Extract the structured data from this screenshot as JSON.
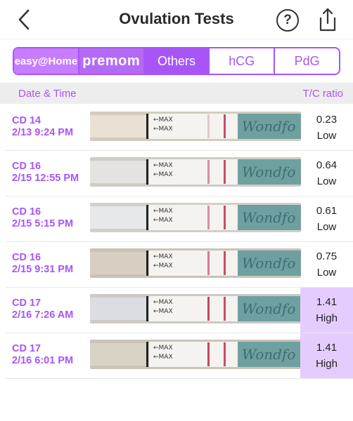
{
  "header": {
    "title": "Ovulation Tests"
  },
  "tabs": [
    {
      "label": "easy@Home",
      "style": "brand"
    },
    {
      "label": "premom",
      "style": "brand2"
    },
    {
      "label": "Others",
      "style": "active"
    },
    {
      "label": "hCG",
      "style": ""
    },
    {
      "label": "PdG",
      "style": ""
    }
  ],
  "columns": {
    "date_time": "Date & Time",
    "tc_ratio": "T/C ratio"
  },
  "colors": {
    "accent": "#a855f7",
    "high_bg": "#e5ccff"
  },
  "tests": [
    {
      "cd": "CD 14",
      "datetime": "2/13 9:24 PM",
      "value": "0.23",
      "level": "Low",
      "strip_bg": "#e9e2d4",
      "line_intensity": 0.25,
      "strip_text": "Wondfo",
      "strip_max": "MAX"
    },
    {
      "cd": "CD 16",
      "datetime": "2/15 12:55 PM",
      "value": "0.64",
      "level": "Low",
      "strip_bg": "#e4e3e0",
      "line_intensity": 0.55,
      "strip_text": "Wondfo",
      "strip_max": "MAX"
    },
    {
      "cd": "CD 16",
      "datetime": "2/15 5:15 PM",
      "value": "0.61",
      "level": "Low",
      "strip_bg": "#e6e8ea",
      "line_intensity": 0.55,
      "strip_text": "Wondfo",
      "strip_max": "MAX"
    },
    {
      "cd": "CD 16",
      "datetime": "2/15 9:31 PM",
      "value": "0.75",
      "level": "Low",
      "strip_bg": "#d8cfc3",
      "line_intensity": 0.65,
      "strip_text": "Wondfo",
      "strip_max": "MAX"
    },
    {
      "cd": "CD 17",
      "datetime": "2/16 7:26 AM",
      "value": "1.41",
      "level": "High",
      "strip_bg": "#dcdde2",
      "line_intensity": 0.95,
      "strip_text": "Wondfo",
      "strip_max": "MAX"
    },
    {
      "cd": "CD 17",
      "datetime": "2/16 6:01 PM",
      "value": "1.41",
      "level": "High",
      "strip_bg": "#d9d3c6",
      "line_intensity": 0.95,
      "strip_text": "Wondfo",
      "strip_max": "MAX"
    }
  ]
}
